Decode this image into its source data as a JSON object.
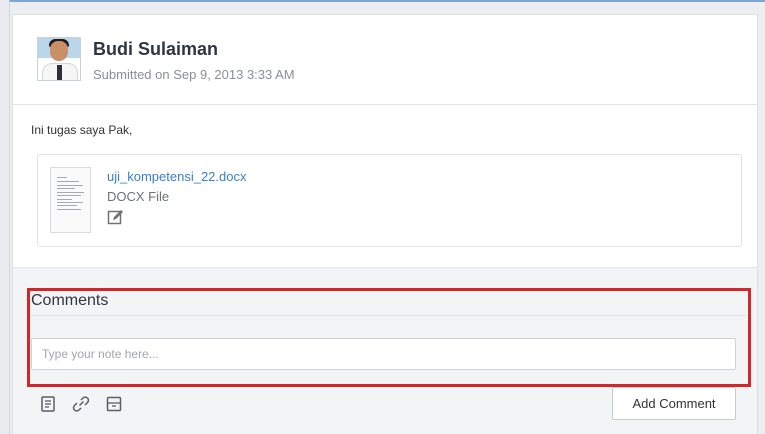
{
  "submission": {
    "author": "Budi Sulaiman",
    "submitted": "Submitted on Sep 9, 2013 3:33 AM",
    "message": "Ini tugas saya Pak,"
  },
  "attachment": {
    "file_name": "uji_kompetensi_22.docx",
    "file_type": "DOCX File",
    "icon": "edit-icon"
  },
  "comments": {
    "title": "Comments",
    "placeholder": "Type your note here...",
    "value": "",
    "tools": [
      "note-icon",
      "link-icon",
      "save-icon"
    ],
    "add_label": "Add Comment"
  },
  "colors": {
    "link": "#3a80c7",
    "highlight": "#d2262b",
    "frame_top": "#7ea6d4"
  }
}
